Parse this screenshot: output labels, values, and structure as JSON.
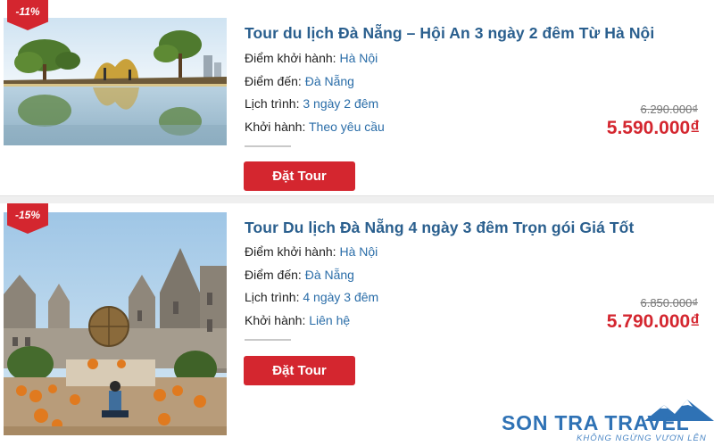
{
  "tours": [
    {
      "discount": "-11%",
      "title": "Tour du lịch Đà Nẵng – Hội An 3 ngày 2 đêm Từ Hà Nội",
      "depart_label": "Điểm khởi hành:",
      "depart_value": "Hà Nội",
      "dest_label": "Điểm đến:",
      "dest_value": "Đà Nẵng",
      "schedule_label": "Lịch trình:",
      "schedule_value": "3 ngày 2 đêm",
      "start_label": "Khởi hành:",
      "start_value": "Theo yêu cầu",
      "old_price": "6.290.000₫",
      "new_price": "5.590.000₫",
      "button": "Đặt Tour"
    },
    {
      "discount": "-15%",
      "title": "Tour Du lịch Đà Nẵng 4 ngày 3 đêm Trọn gói Giá Tốt",
      "depart_label": "Điểm khởi hành:",
      "depart_value": "Hà Nội",
      "dest_label": "Điểm đến:",
      "dest_value": "Đà Nẵng",
      "schedule_label": "Lịch trình:",
      "schedule_value": "4 ngày 3 đêm",
      "start_label": "Khởi hành:",
      "start_value": "Liên hệ",
      "old_price": "6.850.000₫",
      "new_price": "5.790.000₫",
      "button": "Đặt Tour"
    }
  ],
  "logo": {
    "name": "SON TRA TRAVEL",
    "tagline": "KHÔNG NGỪNG VƯƠN LÊN"
  },
  "colors": {
    "accent_red": "#d4262f",
    "title_blue": "#2a5f8e",
    "value_blue": "#2a6da8"
  }
}
